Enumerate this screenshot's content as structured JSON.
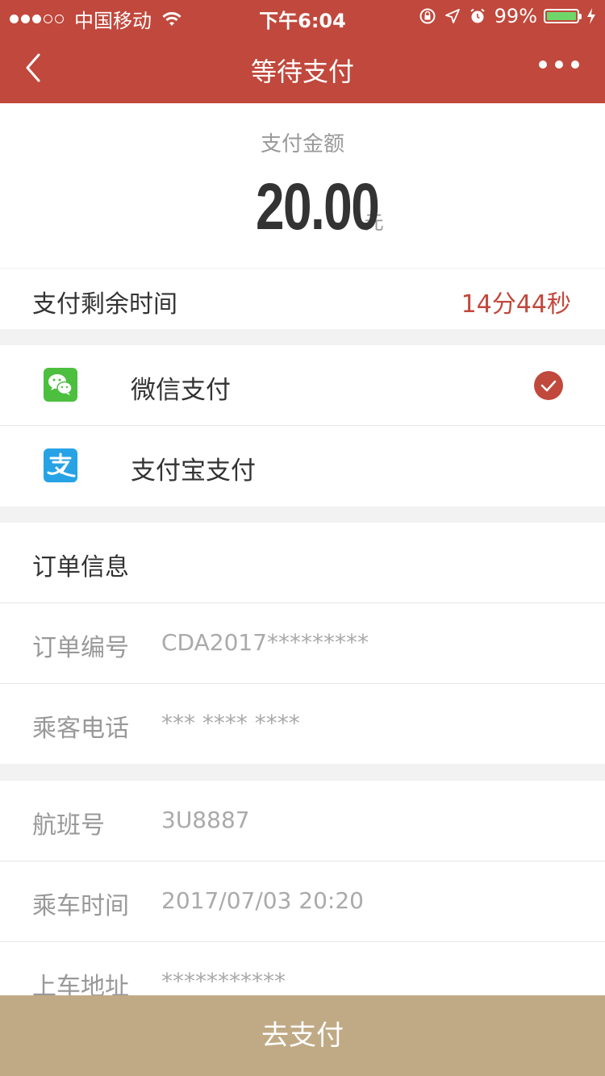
{
  "status_bar": {
    "carrier": "中国移动",
    "time": "下午6:04",
    "battery": "99%",
    "battery_level": 0.99
  },
  "nav": {
    "title": "等待支付"
  },
  "amount": {
    "label": "支付金额",
    "value": "20.00",
    "unit": "元"
  },
  "timer": {
    "label": "支付剩余时间",
    "value": "14分44秒"
  },
  "payment_methods": [
    {
      "label": "微信支付",
      "icon": "wechat-icon",
      "selected": true
    },
    {
      "label": "支付宝支付",
      "icon": "alipay-icon",
      "selected": false
    }
  ],
  "order": {
    "title": "订单信息",
    "number_label": "订单编号",
    "number_value": "CDA2017*********",
    "phone_label": "乘客电话",
    "phone_value": "*** **** ****"
  },
  "trip": {
    "flight_label": "航班号",
    "flight_value": "3U8887",
    "time_label": "乘车时间",
    "time_value": "2017/07/03 20:20",
    "address_label": "上车地址",
    "address_value": "***********"
  },
  "action": {
    "pay_label": "去支付"
  },
  "colors": {
    "primary": "#c1483c",
    "button": "#c0aa85",
    "wechat": "#4cbf3f",
    "alipay": "#27a3e5"
  }
}
